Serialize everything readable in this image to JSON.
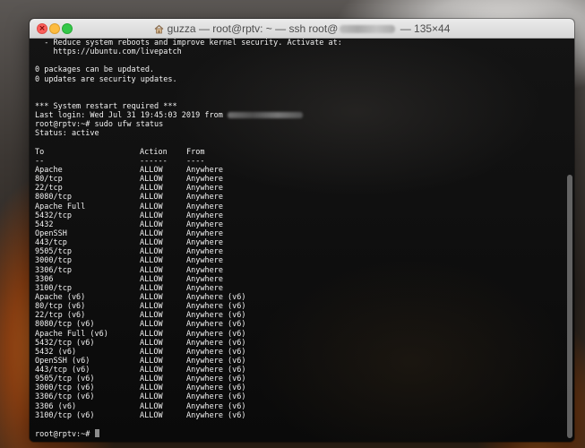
{
  "window": {
    "title_user_prefix": "guzza",
    "title_main": " — root@rptv: ~ — ssh root@",
    "title_suffix": " — 135×44"
  },
  "terminal": {
    "motd_lines": [
      "  - Reduce system reboots and improve kernel security. Activate at:",
      "    https://ubuntu.com/livepatch",
      "",
      "0 packages can be updated.",
      "0 updates are security updates.",
      "",
      "",
      "*** System restart required ***"
    ],
    "last_login_text": "Last login: Wed Jul 31 19:45:03 2019 from ",
    "command_line": "root@rptv:~# sudo ufw status",
    "status_line": "Status: active",
    "table": {
      "headers": [
        "To",
        "Action",
        "From"
      ],
      "separators": [
        "--",
        "------",
        "----"
      ],
      "rows": [
        [
          "Apache",
          "ALLOW",
          "Anywhere"
        ],
        [
          "80/tcp",
          "ALLOW",
          "Anywhere"
        ],
        [
          "22/tcp",
          "ALLOW",
          "Anywhere"
        ],
        [
          "8080/tcp",
          "ALLOW",
          "Anywhere"
        ],
        [
          "Apache Full",
          "ALLOW",
          "Anywhere"
        ],
        [
          "5432/tcp",
          "ALLOW",
          "Anywhere"
        ],
        [
          "5432",
          "ALLOW",
          "Anywhere"
        ],
        [
          "OpenSSH",
          "ALLOW",
          "Anywhere"
        ],
        [
          "443/tcp",
          "ALLOW",
          "Anywhere"
        ],
        [
          "9505/tcp",
          "ALLOW",
          "Anywhere"
        ],
        [
          "3000/tcp",
          "ALLOW",
          "Anywhere"
        ],
        [
          "3306/tcp",
          "ALLOW",
          "Anywhere"
        ],
        [
          "3306",
          "ALLOW",
          "Anywhere"
        ],
        [
          "3100/tcp",
          "ALLOW",
          "Anywhere"
        ],
        [
          "Apache (v6)",
          "ALLOW",
          "Anywhere (v6)"
        ],
        [
          "80/tcp (v6)",
          "ALLOW",
          "Anywhere (v6)"
        ],
        [
          "22/tcp (v6)",
          "ALLOW",
          "Anywhere (v6)"
        ],
        [
          "8080/tcp (v6)",
          "ALLOW",
          "Anywhere (v6)"
        ],
        [
          "Apache Full (v6)",
          "ALLOW",
          "Anywhere (v6)"
        ],
        [
          "5432/tcp (v6)",
          "ALLOW",
          "Anywhere (v6)"
        ],
        [
          "5432 (v6)",
          "ALLOW",
          "Anywhere (v6)"
        ],
        [
          "OpenSSH (v6)",
          "ALLOW",
          "Anywhere (v6)"
        ],
        [
          "443/tcp (v6)",
          "ALLOW",
          "Anywhere (v6)"
        ],
        [
          "9505/tcp (v6)",
          "ALLOW",
          "Anywhere (v6)"
        ],
        [
          "3000/tcp (v6)",
          "ALLOW",
          "Anywhere (v6)"
        ],
        [
          "3306/tcp (v6)",
          "ALLOW",
          "Anywhere (v6)"
        ],
        [
          "3306 (v6)",
          "ALLOW",
          "Anywhere (v6)"
        ],
        [
          "3100/tcp (v6)",
          "ALLOW",
          "Anywhere (v6)"
        ]
      ]
    },
    "prompt": "root@rptv:~# "
  },
  "icons": {
    "close": "close-icon",
    "minimize": "minimize-icon",
    "maximize": "maximize-icon",
    "home": "home-icon"
  },
  "colors": {
    "traffic_close": "#fc605c",
    "traffic_minimize": "#fdbc40",
    "traffic_maximize": "#34c84a",
    "terminal_text": "#f2f2f2"
  }
}
